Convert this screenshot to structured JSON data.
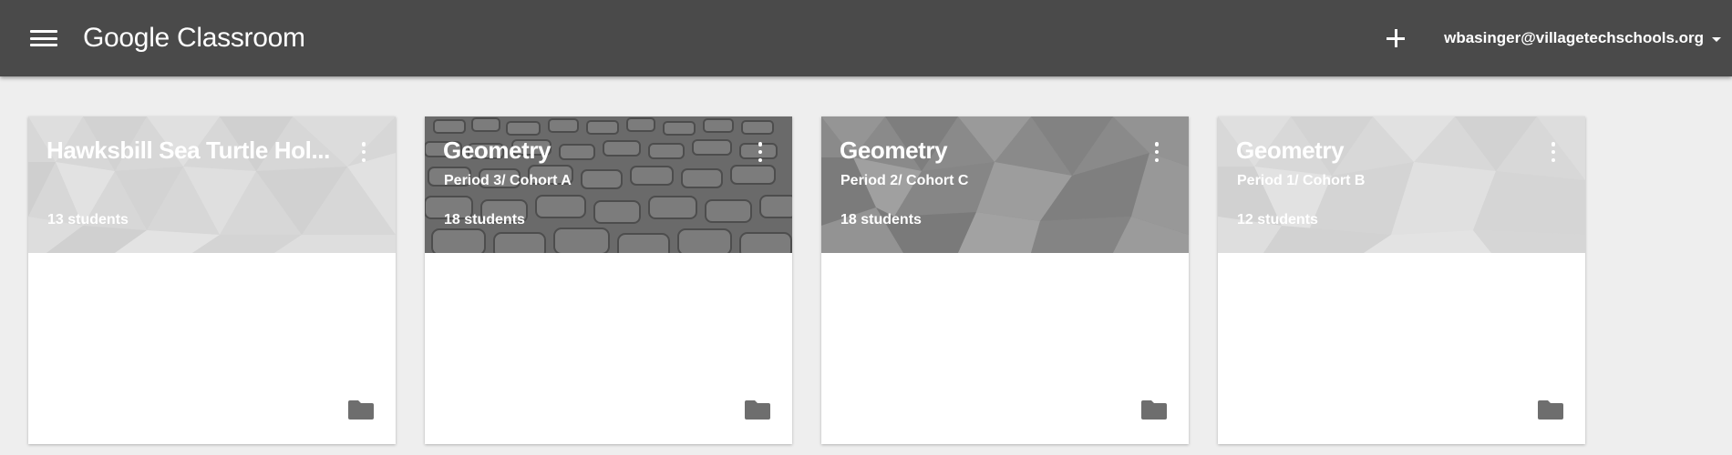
{
  "app": {
    "logo_brand": "Google",
    "logo_product": "Classroom",
    "account_email": "wbasinger@villagetechschools.org"
  },
  "icons": {
    "menu": "hamburger-menu-icon",
    "add": "plus-icon",
    "account_caret": "caret-down-icon",
    "card_menu": "more-vert-icon",
    "folder": "folder-icon"
  },
  "colors": {
    "topbar": "#4a4a4a",
    "page_background": "#eeeeee",
    "folder_icon": "#6e6e6e"
  },
  "classes": [
    {
      "title": "Hawksbill Sea Turtle Hol...",
      "subtitle": "",
      "students": "13 students",
      "theme": "light-triangles"
    },
    {
      "title": "Geometry",
      "subtitle": "Period 3/ Cohort A",
      "students": "18 students",
      "theme": "cobblestone"
    },
    {
      "title": "Geometry",
      "subtitle": "Period 2/ Cohort C",
      "students": "18 students",
      "theme": "kaleidoscope"
    },
    {
      "title": "Geometry",
      "subtitle": "Period 1/ Cohort B",
      "students": "12 students",
      "theme": "pale-triangles"
    }
  ]
}
